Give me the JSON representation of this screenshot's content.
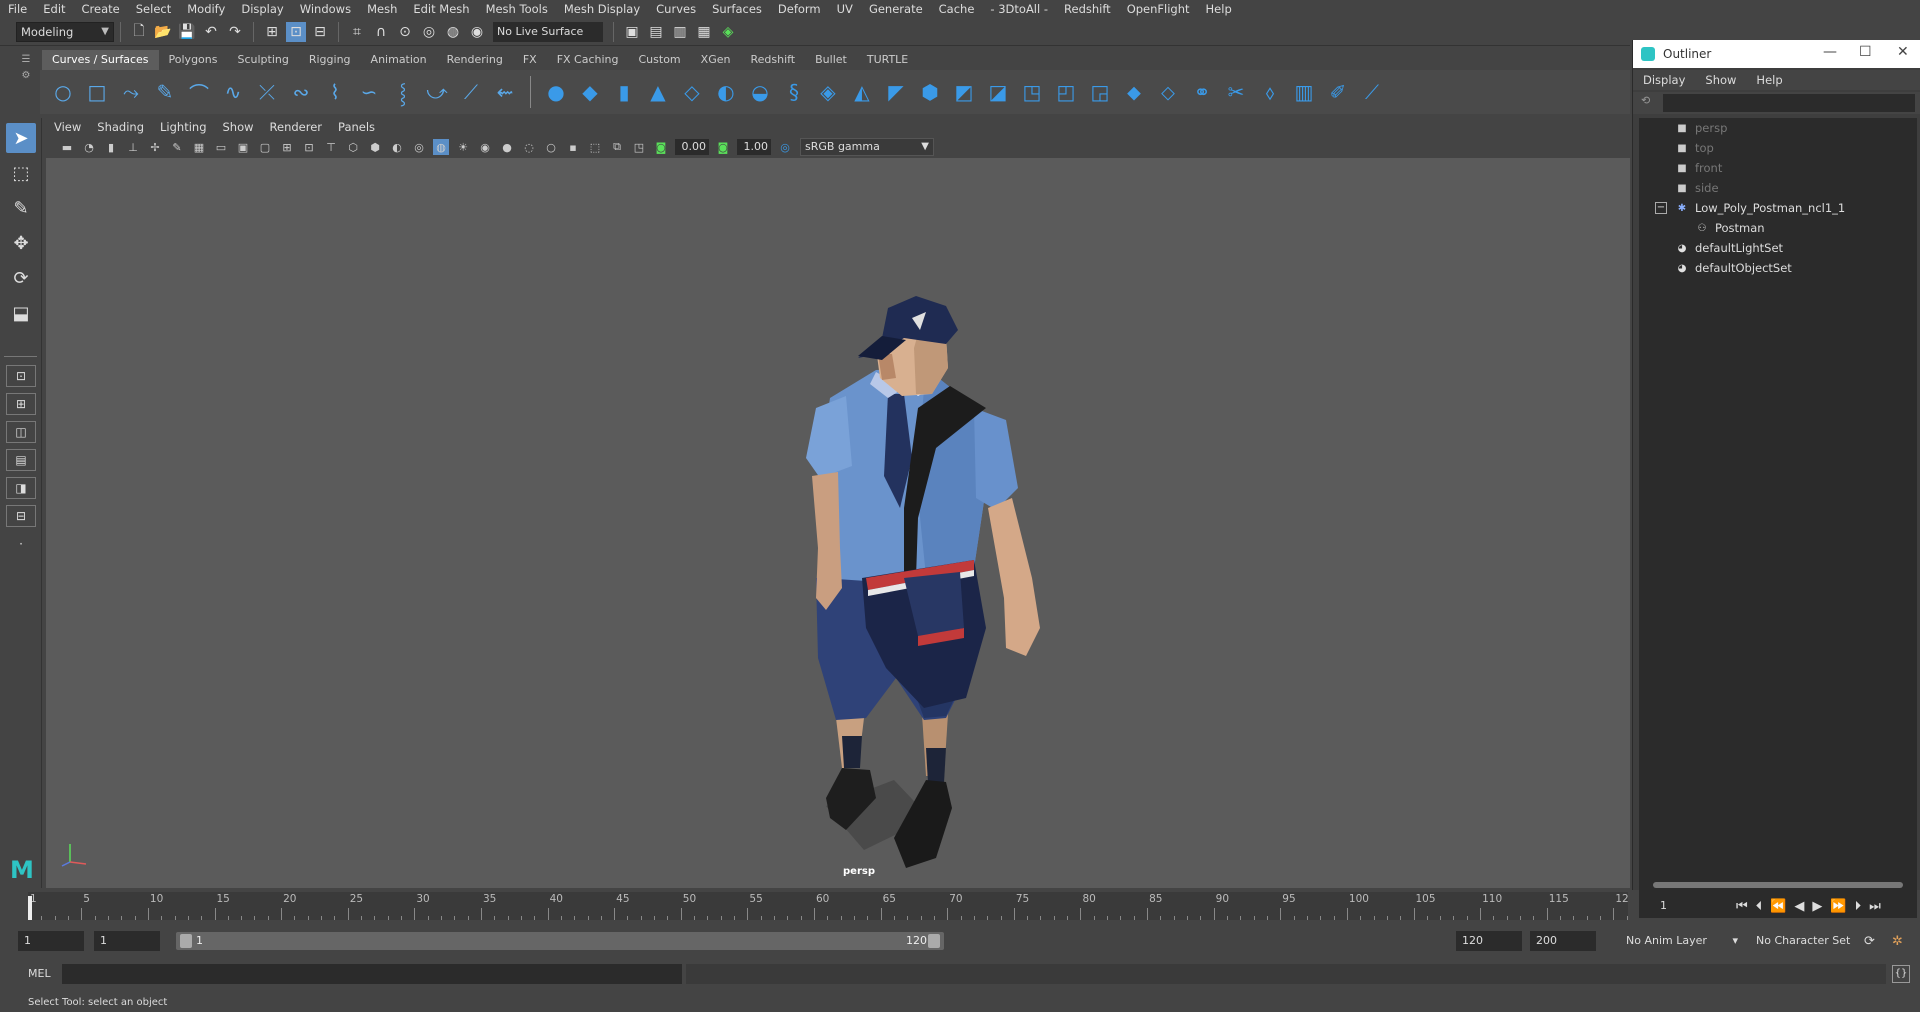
{
  "menubar": [
    "File",
    "Edit",
    "Create",
    "Select",
    "Modify",
    "Display",
    "Windows",
    "Mesh",
    "Edit Mesh",
    "Mesh Tools",
    "Mesh Display",
    "Curves",
    "Surfaces",
    "Deform",
    "UV",
    "Generate",
    "Cache",
    "- 3DtoAll -",
    "Redshift",
    "OpenFlight",
    "Help"
  ],
  "statusline": {
    "mode": "Modeling",
    "live_surface": "No Live Surface"
  },
  "shelf": {
    "tabs": [
      "Curves / Surfaces",
      "Polygons",
      "Sculpting",
      "Rigging",
      "Animation",
      "Rendering",
      "FX",
      "FX Caching",
      "Custom",
      "XGen",
      "Redshift",
      "Bullet",
      "TURTLE"
    ],
    "active_tab": "Curves / Surfaces"
  },
  "panel": {
    "menu": [
      "View",
      "Shading",
      "Lighting",
      "Show",
      "Renderer",
      "Panels"
    ],
    "exposure": "0.00",
    "gamma": "1.00",
    "color_space": "sRGB gamma",
    "camera": "persp"
  },
  "outliner": {
    "title": "Outliner",
    "menu": [
      "Display",
      "Show",
      "Help"
    ],
    "items": [
      {
        "label": "persp",
        "icon": "camera-icon",
        "dim": true
      },
      {
        "label": "top",
        "icon": "camera-icon",
        "dim": true
      },
      {
        "label": "front",
        "icon": "camera-icon",
        "dim": true
      },
      {
        "label": "side",
        "icon": "camera-icon",
        "dim": true
      },
      {
        "label": "Low_Poly_Postman_ncl1_1",
        "icon": "group-icon",
        "dim": false
      },
      {
        "label": "Postman",
        "icon": "mesh-icon",
        "dim": false
      },
      {
        "label": "defaultLightSet",
        "icon": "set-icon",
        "dim": false
      },
      {
        "label": "defaultObjectSet",
        "icon": "set-icon",
        "dim": false
      }
    ]
  },
  "timeline": {
    "ticks": [
      "1",
      "5",
      "10",
      "15",
      "20",
      "25",
      "30",
      "35",
      "40",
      "45",
      "50",
      "55",
      "60",
      "65",
      "70",
      "75",
      "80",
      "85",
      "90",
      "95",
      "100",
      "105",
      "110",
      "115",
      "12"
    ],
    "current_frame": "1"
  },
  "range": {
    "start": "1",
    "playback_start": "1",
    "bar_start": "1",
    "bar_end": "120",
    "playback_end": "120",
    "end": "200",
    "anim_layer": "No Anim Layer",
    "character_set": "No Character Set"
  },
  "cmdline": {
    "label": "MEL"
  },
  "helpline": "Select Tool: select an object",
  "colors": {
    "accent": "#5b8fc7",
    "maya_teal": "#2ec4c4",
    "shelf_icon": "#3a9ae8"
  }
}
